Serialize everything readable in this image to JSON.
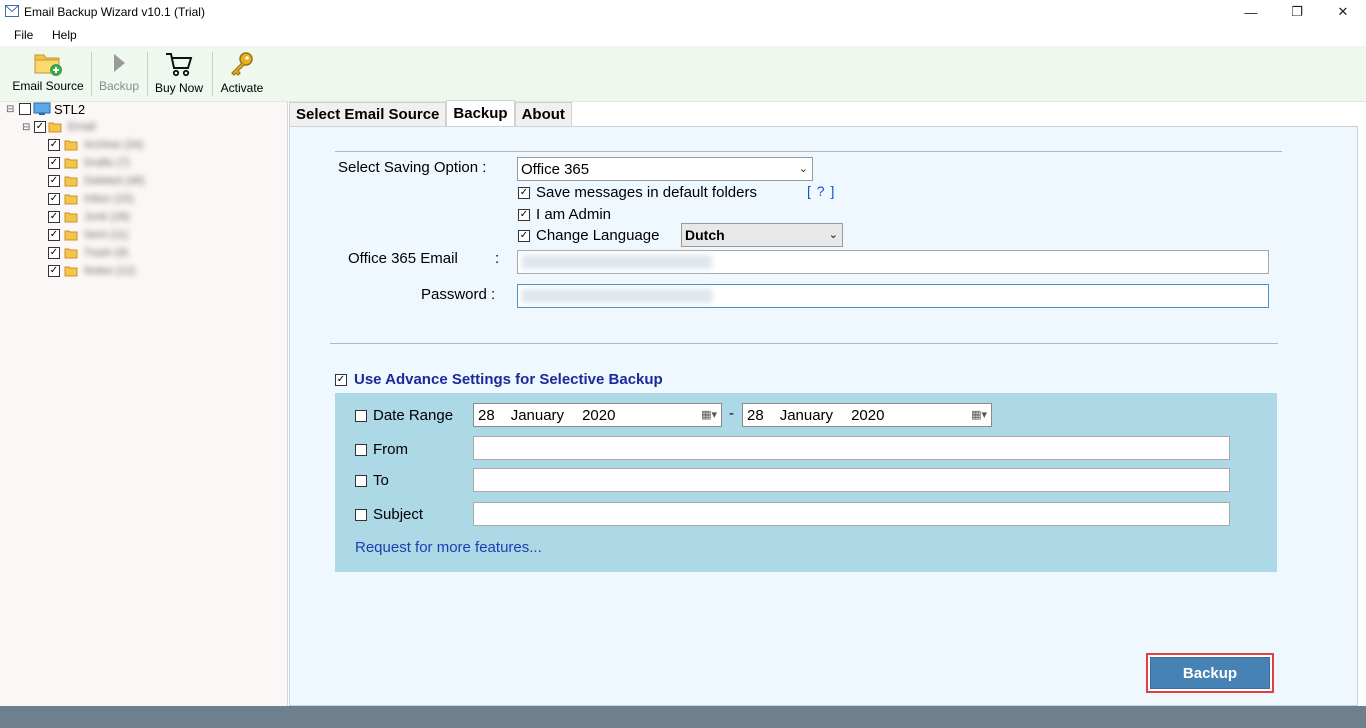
{
  "window": {
    "title": "Email Backup Wizard v10.1 (Trial)",
    "minimize_glyph": "—",
    "restore_glyph": "❐",
    "close_glyph": "✕"
  },
  "menu": {
    "items": [
      "File",
      "Help"
    ]
  },
  "toolbar": {
    "email_source_label": "Email Source",
    "backup_label": "Backup",
    "buy_now_label": "Buy Now",
    "activate_label": "Activate"
  },
  "tree": {
    "root_label": "STL2",
    "child_label": "Email",
    "folders": [
      "Archive (34)",
      "Drafts (7)",
      "Deleted (48)",
      "Inbox (15)",
      "Junk (28)",
      "Sent (11)",
      "Trash (9)",
      "Notes (12)"
    ]
  },
  "tabs": {
    "select_email_source": "Select Email Source",
    "backup": "Backup",
    "about": "About"
  },
  "backup_tab": {
    "saving_option_label": "Select Saving Option :",
    "saving_option_value": "Office 365",
    "save_default_folders_label": "Save messages in default folders",
    "help_link": "[ ? ]",
    "i_am_admin_label": "I am Admin",
    "change_language_label": "Change Language",
    "language_value": "Dutch",
    "office365_email_label": "Office 365 Email",
    "email_colon": ":",
    "email_value": "",
    "password_label": "Password :",
    "password_value": ""
  },
  "advanced": {
    "title": "Use Advance Settings for Selective Backup",
    "date_range_label": "Date Range",
    "date_from": {
      "day": "28",
      "month": "January",
      "year": "2020"
    },
    "date_separator": "-",
    "date_to": {
      "day": "28",
      "month": "January",
      "year": "2020"
    },
    "from_label": "From",
    "to_label": "To",
    "subject_label": "Subject",
    "request_link": "Request for more features..."
  },
  "footer": {
    "backup_button_label": "Backup"
  },
  "colors": {
    "toolbar_bg": "#eef8ee",
    "tree_bg": "#fcf7f7",
    "content_bg": "#f0f8ff",
    "advanced_panel_bg": "#add8e6",
    "backup_button_bg": "#4682b4",
    "backup_button_highlight": "#e04040",
    "status_bar": "#6e7f8d"
  }
}
